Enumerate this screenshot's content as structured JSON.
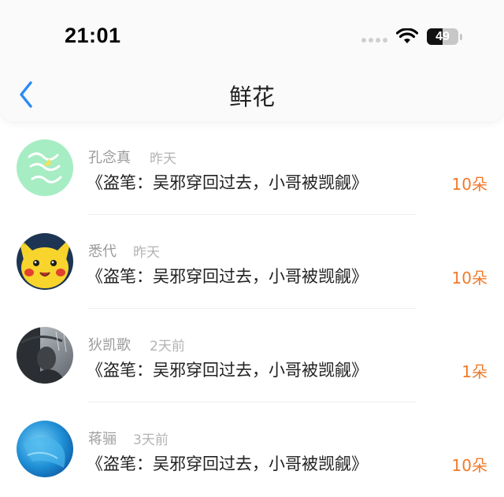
{
  "status_bar": {
    "time": "21:01",
    "battery": "49",
    "battery_level": 0.49
  },
  "header": {
    "title": "鲜花"
  },
  "items": [
    {
      "name": "孔念真",
      "when": "昨天",
      "book": "《盗笔：吴邪穿回过去，小哥被觊觎》",
      "count": "10朵",
      "avatar": "mint-avatar"
    },
    {
      "name": "悉代",
      "when": "昨天",
      "book": "《盗笔：吴邪穿回过去，小哥被觊觎》",
      "count": "10朵",
      "avatar": "pikachu-avatar"
    },
    {
      "name": "狄凯歌",
      "when": "2天前",
      "book": "《盗笔：吴邪穿回过去，小哥被觊觎》",
      "count": "1朵",
      "avatar": "rain-portrait-avatar"
    },
    {
      "name": "蒋骊",
      "when": "3天前",
      "book": "《盗笔：吴邪穿回过去，小哥被觊觎》",
      "count": "10朵",
      "avatar": "blue-avatar"
    }
  ],
  "colors": {
    "accent": "#f07a2a",
    "back_arrow": "#2a8af6",
    "name_gray": "#9a9a9a"
  }
}
